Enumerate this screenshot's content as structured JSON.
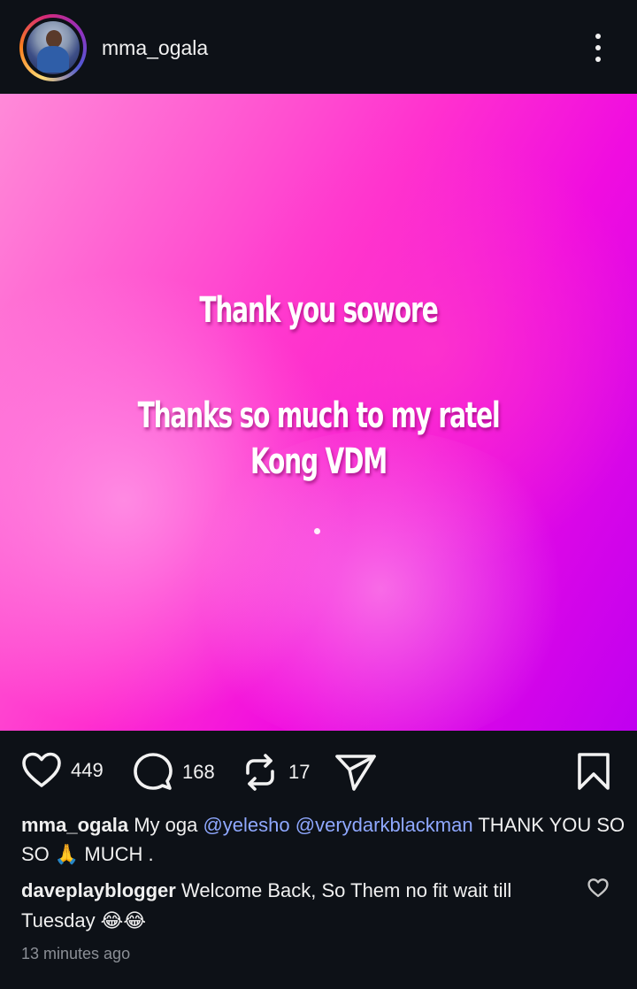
{
  "header": {
    "username": "mma_ogala",
    "more_icon": "more-vertical-icon"
  },
  "post_image": {
    "line1": "Thank you sowore",
    "line2": "Thanks so much to my ratel Kong VDM",
    "colors": {
      "top_left": "#ff8ad8",
      "center": "#ff2fcf",
      "bottom_right": "#c000f0"
    }
  },
  "actions": {
    "likes": "449",
    "comments": "168",
    "reposts": "17",
    "icons": [
      "heart-icon",
      "comment-icon",
      "repost-icon",
      "send-icon",
      "bookmark-icon"
    ]
  },
  "caption": {
    "username": "mma_ogala",
    "text_before": "My oga ",
    "mention1": "@yelesho",
    "mention2": "@verydarkblackman",
    "text_after": "  THANK YOU SO SO 🙏 MUCH ."
  },
  "comment": {
    "username": "daveplayblogger",
    "text": "Welcome Back, So Them no fit wait till Tuesday 😂😂"
  },
  "timestamp": "13 minutes ago",
  "accent_color": "#8fa8ff"
}
